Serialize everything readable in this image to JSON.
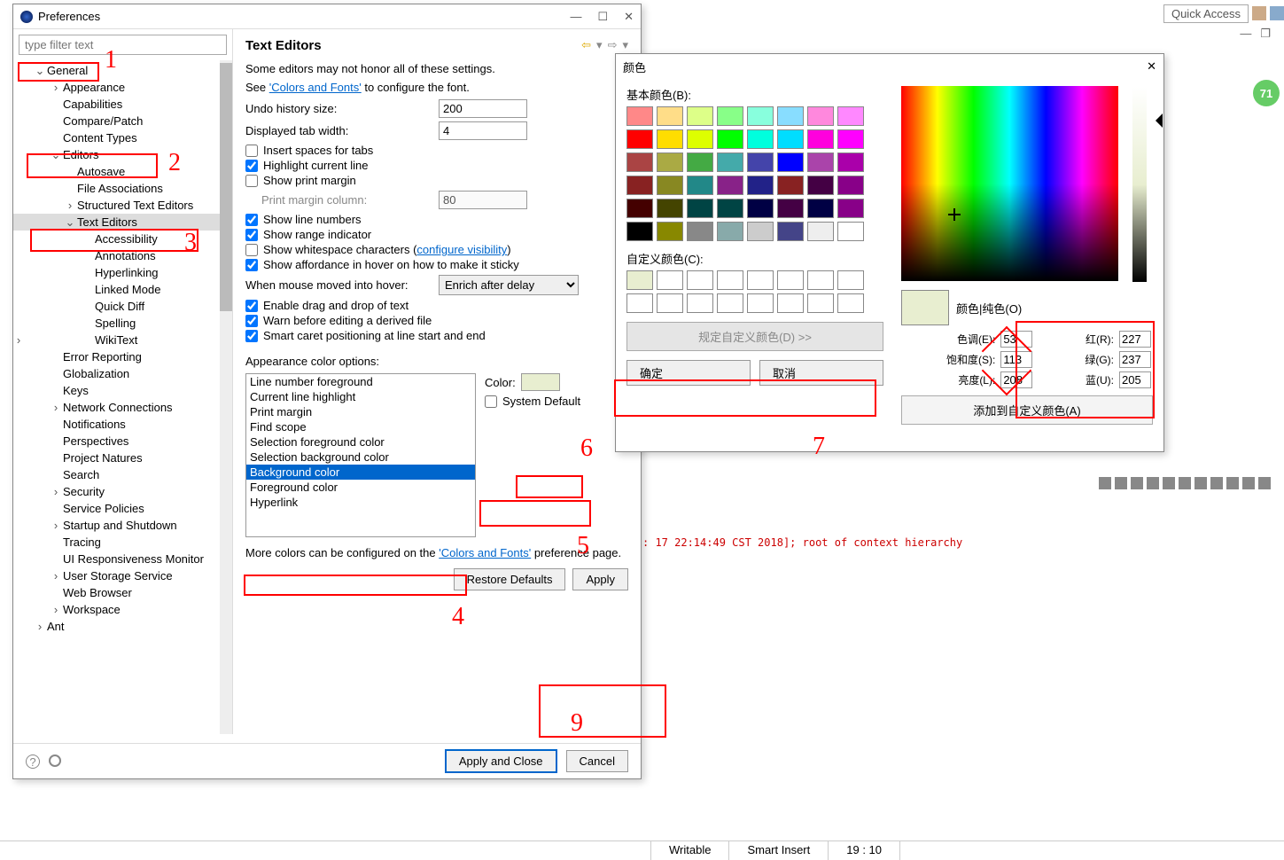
{
  "quick_access": "Quick Access",
  "green_badge": "71",
  "win_icons": {
    "min": "—",
    "restore": "❐"
  },
  "log_text": ": 17 22:14:49 CST 2018]; root of context hierarchy",
  "status": {
    "writable": "Writable",
    "insert": "Smart Insert",
    "pos": "19 : 10"
  },
  "pref": {
    "title": "Preferences",
    "filter_placeholder": "type filter text",
    "section": "Text Editors",
    "note": "Some editors may not honor all of these settings.",
    "see": "See ",
    "colors_fonts": "'Colors and Fonts'",
    "configure_font": " to configure the font.",
    "undo_label": "Undo history size:",
    "undo_val": "200",
    "tab_label": "Displayed tab width:",
    "tab_val": "4",
    "cb_insert_spaces": "Insert spaces for tabs",
    "cb_highlight": "Highlight current line",
    "cb_print_margin": "Show print margin",
    "print_margin_label": "Print margin column:",
    "print_margin_val": "80",
    "cb_line_numbers": "Show line numbers",
    "cb_range": "Show range indicator",
    "cb_whitespace": "Show whitespace characters (",
    "cb_whitespace_link": "configure visibility",
    "cb_whitespace_end": ")",
    "cb_affordance": "Show affordance in hover on how to make it sticky",
    "hover_label": "When mouse moved into hover:",
    "hover_val": "Enrich after delay",
    "cb_dnd": "Enable drag and drop of text",
    "cb_warn": "Warn before editing a derived file",
    "cb_caret": "Smart caret positioning at line start and end",
    "appearance_label": "Appearance color options:",
    "list": [
      "Line number foreground",
      "Current line highlight",
      "Print margin",
      "Find scope",
      "Selection foreground color",
      "Selection background color",
      "Background color",
      "Foreground color",
      "Hyperlink"
    ],
    "color_label": "Color:",
    "system_default": "System Default",
    "more_colors": "More colors can be configured on the ",
    "more_colors_link": "'Colors and Fonts'",
    "more_colors_end": " preference page.",
    "restore": "Restore Defaults",
    "apply": "Apply",
    "apply_close": "Apply and Close",
    "cancel": "Cancel"
  },
  "tree": {
    "general": "General",
    "appearance": "Appearance",
    "capabilities": "Capabilities",
    "compare": "Compare/Patch",
    "content_types": "Content Types",
    "editors": "Editors",
    "autosave": "Autosave",
    "file_assoc": "File Associations",
    "structured": "Structured Text Editors",
    "text_editors": "Text Editors",
    "accessibility": "Accessibility",
    "annotations": "Annotations",
    "hyperlinking": "Hyperlinking",
    "linked_mode": "Linked Mode",
    "quick_diff": "Quick Diff",
    "spelling": "Spelling",
    "wikitext": "WikiText",
    "error_reporting": "Error Reporting",
    "globalization": "Globalization",
    "keys": "Keys",
    "network": "Network Connections",
    "notifications": "Notifications",
    "perspectives": "Perspectives",
    "project_natures": "Project Natures",
    "search": "Search",
    "security": "Security",
    "service_policies": "Service Policies",
    "startup": "Startup and Shutdown",
    "tracing": "Tracing",
    "ui_resp": "UI Responsiveness Monitor",
    "user_storage": "User Storage Service",
    "web_browser": "Web Browser",
    "workspace": "Workspace",
    "ant": "Ant"
  },
  "color": {
    "title": "颜色",
    "basic": "基本颜色(B):",
    "custom": "自定义颜色(C):",
    "define": "规定自定义颜色(D) >>",
    "ok": "确定",
    "cancel": "取消",
    "solid": "颜色|纯色(O)",
    "hue": "色调(E):",
    "hue_v": "53",
    "sat": "饱和度(S):",
    "sat_v": "113",
    "lum": "亮度(L):",
    "lum_v": "208",
    "r": "红(R):",
    "r_v": "227",
    "g": "绿(G):",
    "g_v": "237",
    "b": "蓝(U):",
    "b_v": "205",
    "add": "添加到自定义颜色(A)"
  },
  "basic_colors": [
    "#f88",
    "#fd8",
    "#df8",
    "#8f8",
    "#8fd",
    "#8df",
    "#f8d",
    "#f8f",
    "#f00",
    "#fd0",
    "#df0",
    "#0f0",
    "#0fd",
    "#0df",
    "#f0d",
    "#f0f",
    "#a44",
    "#aa4",
    "#4a4",
    "#4aa",
    "#44a",
    "#00f",
    "#a4a",
    "#a0a",
    "#822",
    "#882",
    "#288",
    "#828",
    "#228",
    "#822",
    "#404",
    "#808",
    "#400",
    "#440",
    "#044",
    "#044",
    "#004",
    "#404",
    "#004",
    "#808",
    "#000",
    "#880",
    "#888",
    "#8aa",
    "#ccc",
    "#448",
    "#eee",
    "#fff"
  ]
}
